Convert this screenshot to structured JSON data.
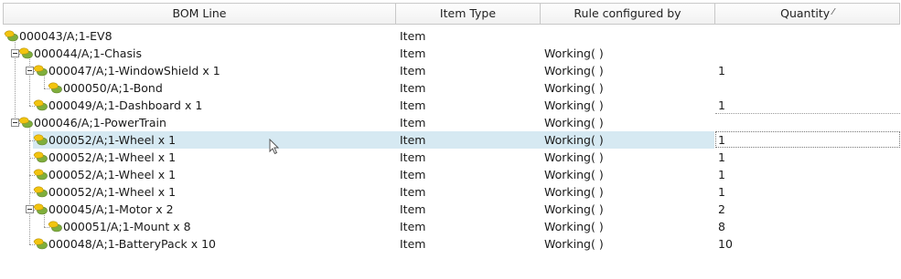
{
  "columns": [
    {
      "label": "BOM Line"
    },
    {
      "label": "Item Type"
    },
    {
      "label": "Rule configured by"
    },
    {
      "label": "Quantity",
      "sort_icon": "sort-indicator-icon"
    }
  ],
  "rows": [
    {
      "label": "000043/A;1-EV8",
      "type": "Item",
      "rule": "",
      "qty": ""
    },
    {
      "label": "000044/A;1-Chasis",
      "type": "Item",
      "rule": "Working( )",
      "qty": ""
    },
    {
      "label": "000047/A;1-WindowShield x 1",
      "type": "Item",
      "rule": "Working( )",
      "qty": "1"
    },
    {
      "label": "000050/A;1-Bond",
      "type": "Item",
      "rule": "Working( )",
      "qty": ""
    },
    {
      "label": "000049/A;1-Dashboard x 1",
      "type": "Item",
      "rule": "Working( )",
      "qty": "1"
    },
    {
      "label": "000046/A;1-PowerTrain",
      "type": "Item",
      "rule": "Working( )",
      "qty": ""
    },
    {
      "label": "000052/A;1-Wheel x 1",
      "type": "Item",
      "rule": "Working( )",
      "qty": "1"
    },
    {
      "label": "000052/A;1-Wheel x 1",
      "type": "Item",
      "rule": "Working( )",
      "qty": "1"
    },
    {
      "label": "000052/A;1-Wheel x 1",
      "type": "Item",
      "rule": "Working( )",
      "qty": "1"
    },
    {
      "label": "000052/A;1-Wheel x 1",
      "type": "Item",
      "rule": "Working( )",
      "qty": "1"
    },
    {
      "label": "000045/A;1-Motor x 2",
      "type": "Item",
      "rule": "Working( )",
      "qty": "2"
    },
    {
      "label": "000051/A;1-Mount x 8",
      "type": "Item",
      "rule": "Working( )",
      "qty": "8"
    },
    {
      "label": "000048/A;1-BatteryPack x 10",
      "type": "Item",
      "rule": "Working( )",
      "qty": "10"
    }
  ],
  "colors": {
    "selection": "#d6e9f2",
    "icon_yellow": "#f2c40f",
    "icon_green": "#7fae3c"
  }
}
